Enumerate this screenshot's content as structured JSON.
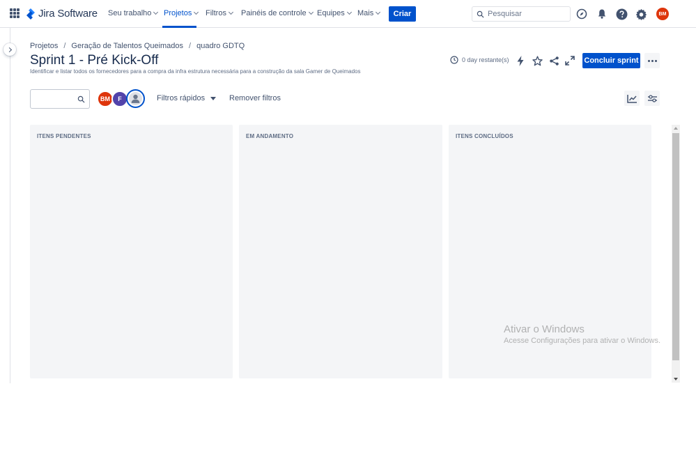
{
  "brand": {
    "name": "Jira Software",
    "accent": "#0052cc",
    "logo_icon": "jira-logo-icon"
  },
  "topnav": {
    "items": [
      {
        "label": "Seu trabalho",
        "active": false
      },
      {
        "label": "Projetos",
        "active": true
      },
      {
        "label": "Filtros",
        "active": false
      },
      {
        "label": "Painéis de controle",
        "active": false
      },
      {
        "label": "Equipes",
        "active": false
      },
      {
        "label": "Mais",
        "active": false
      }
    ],
    "create_label": "Criar",
    "search_placeholder": "Pesquisar",
    "icons": [
      "compass-icon",
      "bell-icon",
      "help-icon",
      "gear-icon"
    ],
    "avatar_initials": "BM",
    "avatar_color": "#de350b"
  },
  "breadcrumb": [
    "Projetos",
    "Geração de Talentos Queimados",
    "quadro GDTQ"
  ],
  "sprint": {
    "title": "Sprint 1 - Pré Kick-Off",
    "goal": "Identificar e listar todos os fornecedores para a compra da infra estrutura necessária para a construção da sala Gamer de Queimados",
    "remaining": "0 day restante(s)",
    "complete_label": "Concluir sprint"
  },
  "filters": {
    "avatars": [
      {
        "initials": "BM",
        "color": "#de350b"
      },
      {
        "initials": "F",
        "color": "#5243aa"
      }
    ],
    "quick_filters_label": "Filtros rápidos",
    "clear_filters_label": "Remover filtros"
  },
  "columns": [
    {
      "title": "ITENS PENDENTES"
    },
    {
      "title": "EM ANDAMENTO"
    },
    {
      "title": "ITENS CONCLUÍDOS"
    }
  ],
  "watermark": {
    "title": "Ativar o Windows",
    "subtitle": "Acesse Configurações para ativar o Windows."
  }
}
